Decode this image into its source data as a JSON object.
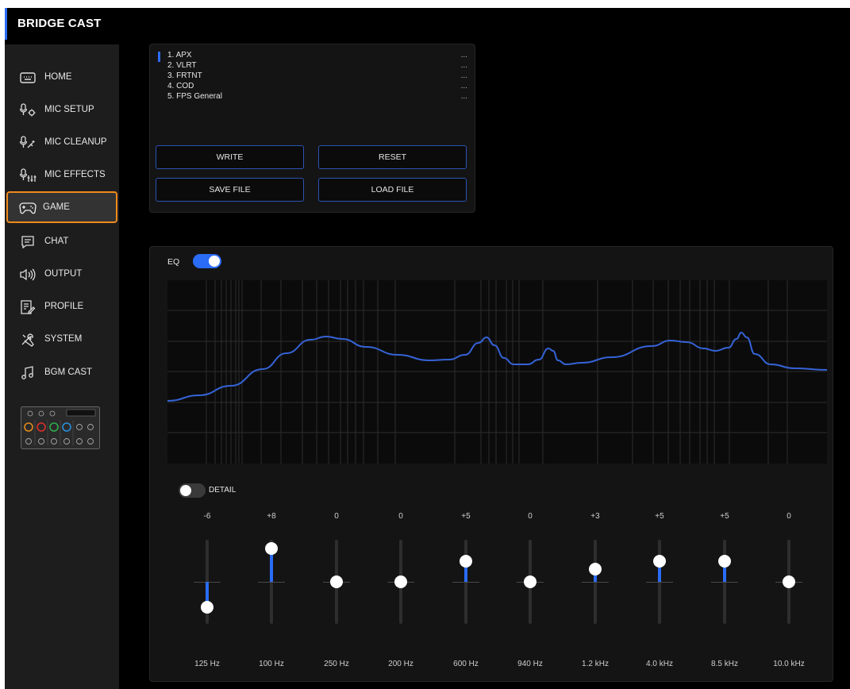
{
  "app": {
    "title": "BRIDGE CAST"
  },
  "colors": {
    "accent": "#2b6cf6",
    "active_outline": "#f08a1c",
    "curve": "#3563d6"
  },
  "sidebar": {
    "items": [
      {
        "label": "HOME",
        "icon": "keyboard-icon"
      },
      {
        "label": "MIC SETUP",
        "icon": "mic-gear-icon"
      },
      {
        "label": "MIC CLEANUP",
        "icon": "mic-sparkle-icon"
      },
      {
        "label": "MIC EFFECTS",
        "icon": "mic-sliders-icon"
      },
      {
        "label": "GAME",
        "icon": "gamepad-icon"
      },
      {
        "label": "CHAT",
        "icon": "chat-icon"
      },
      {
        "label": "OUTPUT",
        "icon": "speaker-icon"
      },
      {
        "label": "PROFILE",
        "icon": "profile-icon"
      },
      {
        "label": "SYSTEM",
        "icon": "tools-icon"
      },
      {
        "label": "BGM CAST",
        "icon": "music-note-icon"
      }
    ],
    "active": "GAME"
  },
  "presets": {
    "items": [
      {
        "name": "1. APX",
        "value": "..."
      },
      {
        "name": "2. VLRT",
        "value": "..."
      },
      {
        "name": "3. FRTNT",
        "value": "..."
      },
      {
        "name": "4. COD",
        "value": "..."
      },
      {
        "name": "5. FPS General",
        "value": "..."
      }
    ],
    "selected": "1. APX"
  },
  "buttons": {
    "write": "WRITE",
    "reset": "RESET",
    "save_file": "SAVE FILE",
    "load_file": "LOAD FILE"
  },
  "eq": {
    "label": "EQ",
    "enabled": true,
    "detail_label": "DETAIL",
    "detail_enabled": false,
    "bands": [
      {
        "value": "-6",
        "freq": "125 Hz",
        "gain": -6
      },
      {
        "value": "+8",
        "freq": "100 Hz",
        "gain": 8
      },
      {
        "value": "0",
        "freq": "250 Hz",
        "gain": 0
      },
      {
        "value": "0",
        "freq": "200 Hz",
        "gain": 0
      },
      {
        "value": "+5",
        "freq": "600 Hz",
        "gain": 5
      },
      {
        "value": "0",
        "freq": "940 Hz",
        "gain": 0
      },
      {
        "value": "+3",
        "freq": "1.2 kHz",
        "gain": 3
      },
      {
        "value": "+5",
        "freq": "4.0 kHz",
        "gain": 5
      },
      {
        "value": "+5",
        "freq": "8.5 kHz",
        "gain": 5
      },
      {
        "value": "0",
        "freq": "10.0 kHz",
        "gain": 0
      }
    ]
  }
}
